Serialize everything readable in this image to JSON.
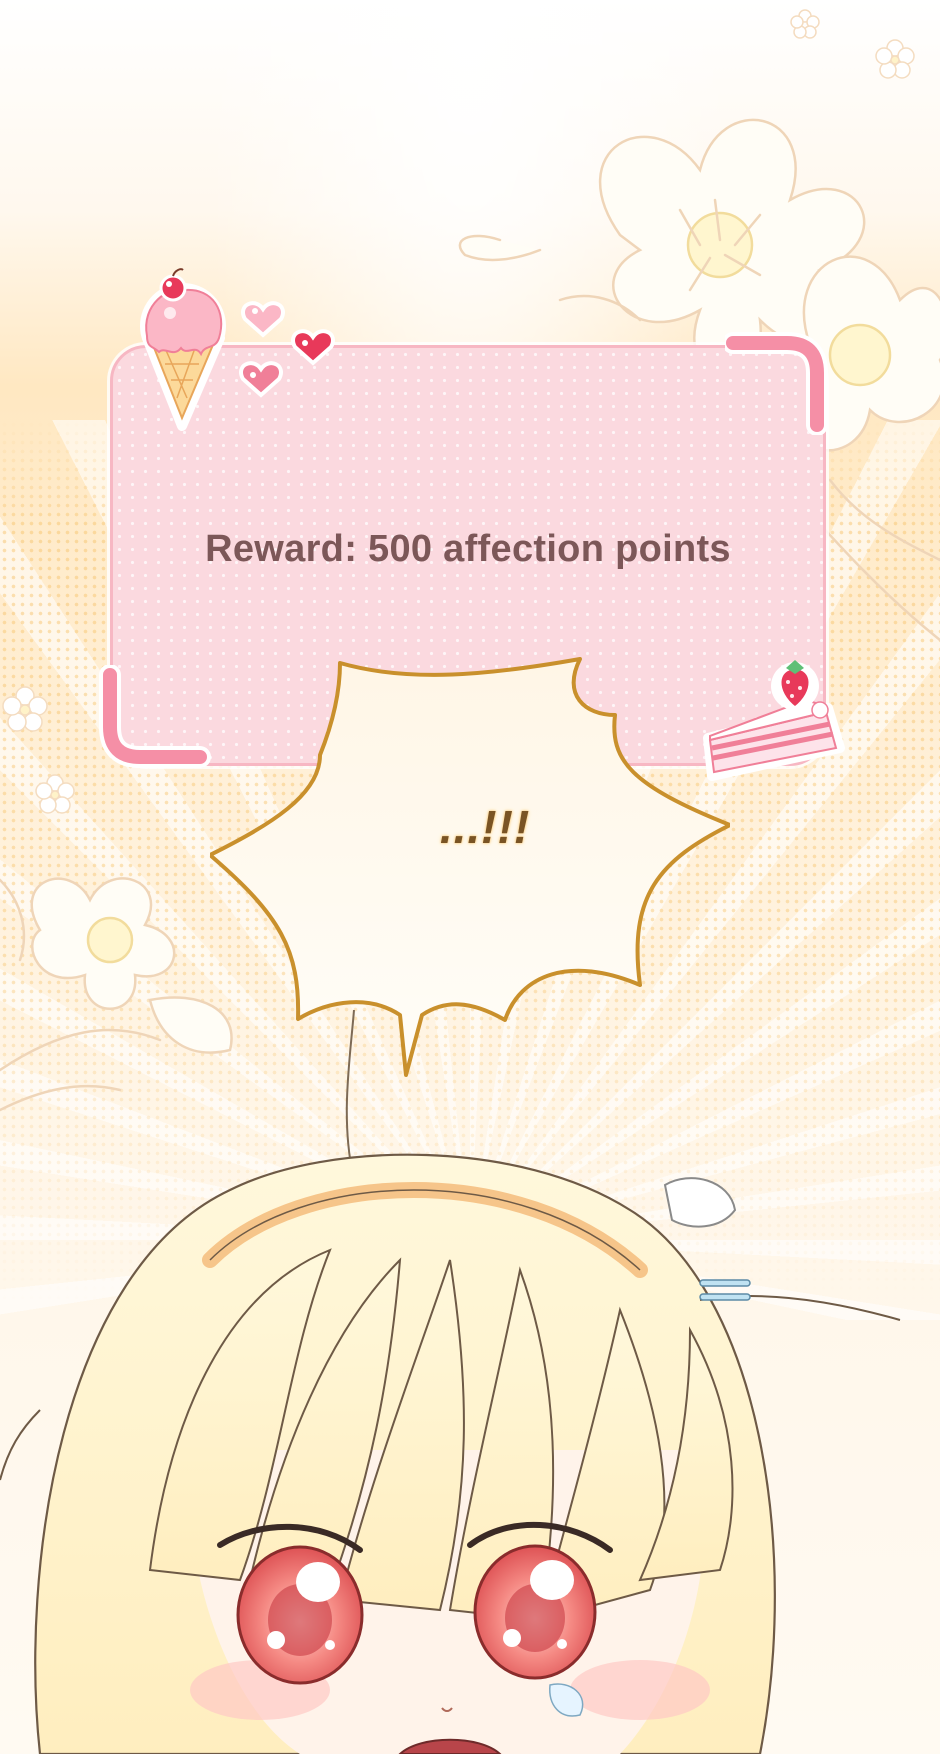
{
  "reward": {
    "text": "Reward: 500 affection points"
  },
  "speech_bubble": {
    "text": "...!!!"
  },
  "stickers": {
    "top_left": "ice-cream-cone",
    "hearts": "heart-stickers",
    "bottom_right": "strawberry-cake-slice"
  },
  "colors": {
    "card_fill": "#fbd9df",
    "card_border": "#f7b7c3",
    "bracket_pink": "#f58fa6",
    "reward_text": "#7c5758",
    "bubble_outline": "#c9902c",
    "hair": "#fff2c4",
    "eyes": "#f26b6b"
  }
}
